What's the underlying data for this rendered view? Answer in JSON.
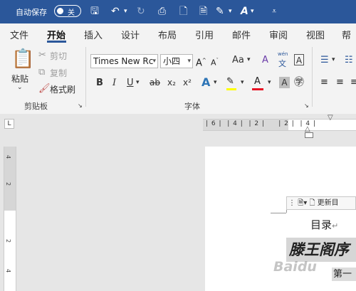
{
  "titlebar": {
    "autosave_label": "自动保存",
    "toggle_state": "关",
    "icons": [
      "save-icon",
      "undo-icon",
      "redo-icon",
      "print-preview-icon",
      "new-document-icon",
      "open-icon",
      "highlight-icon",
      "text-effects-icon",
      "customize-toolbar-icon"
    ]
  },
  "tabs": [
    "文件",
    "开始",
    "插入",
    "设计",
    "布局",
    "引用",
    "邮件",
    "审阅",
    "视图",
    "帮助"
  ],
  "active_tab": "开始",
  "clipboard": {
    "paste": "粘贴",
    "cut": "剪切",
    "copy": "复制",
    "format_painter": "格式刷",
    "group_label": "剪贴板"
  },
  "font": {
    "font_name": "Times New Rc",
    "font_size": "小四",
    "case_label": "Aa",
    "phonetic_glyph": "wén",
    "phonetic_char": "文",
    "border_char": "A",
    "bold": "B",
    "italic": "I",
    "underline": "U",
    "strike": "ab",
    "subscript": "x₂",
    "superscript": "x²",
    "group_label": "字体"
  },
  "ruler": {
    "horizontal": "| 6 |  | 4 |  | 2 |     | 2 |  | 4 |",
    "vertical": [
      "4",
      "2",
      "",
      "2",
      "4"
    ]
  },
  "document": {
    "toc_toolbar_label": "更新目",
    "toc_title": "目录",
    "heading_text": "滕王阁序",
    "chapter_text": "第一",
    "watermark": "Baidu"
  },
  "colors": {
    "title_bar": "#2b579a",
    "font_color_bar": "#e81123",
    "highlight_bar": "#ffff00"
  }
}
